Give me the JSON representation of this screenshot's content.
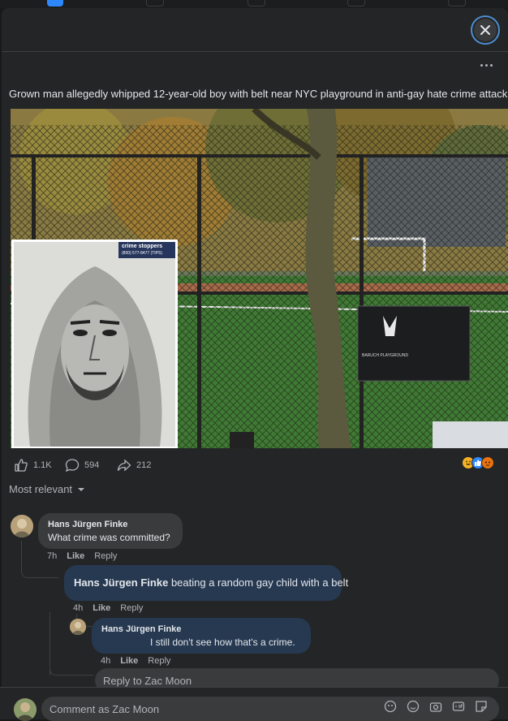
{
  "post": {
    "headline": "Grown man allegedly whipped 12-year-old boy with belt near NYC playground in anti-gay hate crime attack",
    "photo_sign_text": "BARUCH PLAYGROUND",
    "crimestoppers_badge": "crime stoppers",
    "crimestoppers_phone": "(800) 577-8477 (TIPS)"
  },
  "stats": {
    "likes": "1.1K",
    "comments": "594",
    "shares": "212"
  },
  "sort_label": "Most relevant",
  "comments": [
    {
      "author": "Hans Jürgen Finke",
      "text": "What crime was committed?",
      "time": "7h",
      "like": "Like",
      "reply": "Reply"
    }
  ],
  "replies": [
    {
      "author": "Hans Jürgen Finke",
      "text": "beating a random gay child with a belt",
      "time": "4h",
      "like": "Like",
      "reply": "Reply"
    },
    {
      "author": "Hans Jürgen Finke",
      "text": "I still don't see how that's a crime.",
      "time": "4h",
      "like": "Like",
      "reply": "Reply"
    }
  ],
  "reply_box_placeholder": "Reply to Zac Moon",
  "comment_placeholder": "Comment as Zac Moon",
  "colors": {
    "background": "#18191a",
    "surface": "#242526",
    "bubble": "#3a3b3c",
    "reply_bubble": "#263951",
    "accent": "#2d88ff"
  }
}
